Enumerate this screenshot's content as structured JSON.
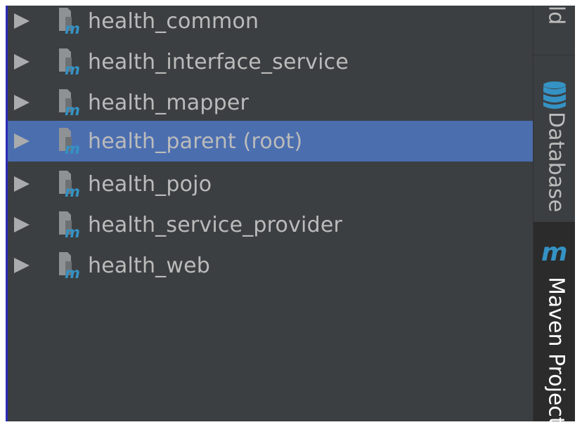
{
  "colors": {
    "panel_bg": "#3c3f41",
    "selection_bg": "#4b6eaf",
    "text": "#bbbbbb",
    "maven_m": "#3592c4",
    "active_tab_bg": "#2b2b2b"
  },
  "tree": {
    "items": [
      {
        "label": "health_common",
        "icon": "maven-module-icon",
        "expand_icon": "expand-arrow-icon"
      },
      {
        "label": "health_interface_service",
        "icon": "maven-module-icon",
        "expand_icon": "expand-arrow-icon"
      },
      {
        "label": "health_mapper",
        "icon": "maven-module-icon",
        "expand_icon": "expand-arrow-icon"
      },
      {
        "label": "health_parent (root)",
        "icon": "maven-module-icon",
        "expand_icon": "expand-arrow-icon",
        "selected": true
      },
      {
        "label": "health_pojo",
        "icon": "maven-module-icon",
        "expand_icon": "expand-arrow-icon"
      },
      {
        "label": "health_service_provider",
        "icon": "maven-module-icon",
        "expand_icon": "expand-arrow-icon"
      },
      {
        "label": "health_web",
        "icon": "maven-module-icon",
        "expand_icon": "expand-arrow-icon"
      }
    ]
  },
  "sidebar": {
    "tabs": [
      {
        "label": "Build",
        "icon": ""
      },
      {
        "label": "Database",
        "icon": "database-icon"
      },
      {
        "label": "Maven Projects",
        "icon": "maven-icon",
        "active": true
      }
    ]
  }
}
